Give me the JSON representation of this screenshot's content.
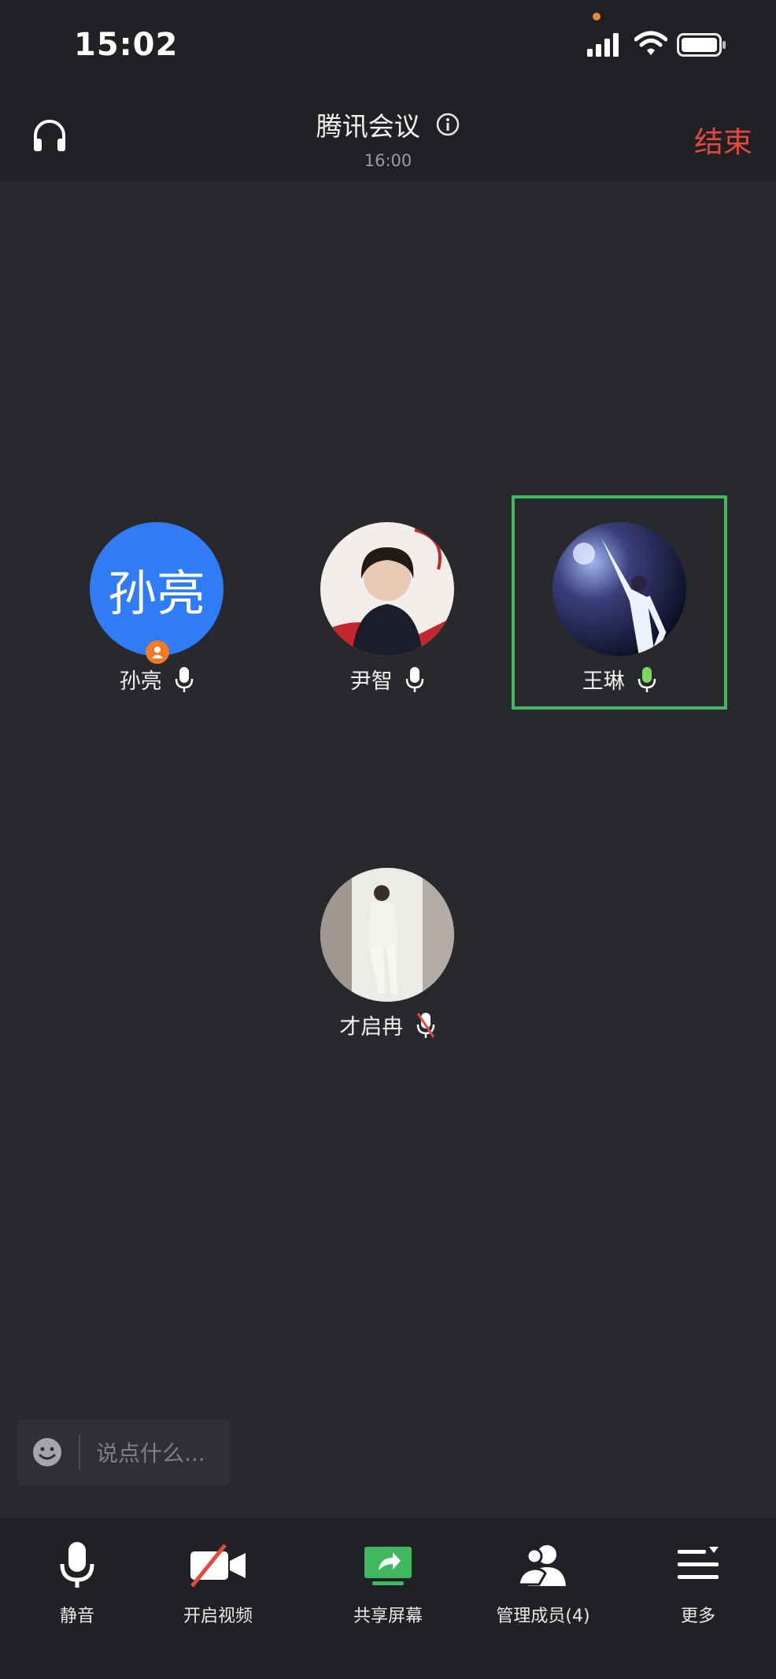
{
  "status_bar": {
    "time": "15:02",
    "icons": [
      "signal-icon",
      "wifi-icon",
      "battery-icon"
    ]
  },
  "header": {
    "title": "腾讯会议",
    "time": "16:00",
    "end_label": "结束",
    "end_color": "#e2493f",
    "icons": [
      "headset-icon",
      "info-icon"
    ]
  },
  "participants": [
    {
      "name": "孙亮",
      "avatar_text": "孙亮",
      "mic": "on",
      "host": true,
      "avatar_color": "#2f7cf6"
    },
    {
      "name": "尹智",
      "mic": "on"
    },
    {
      "name": "王琳",
      "mic": "speaking",
      "active": true,
      "active_color": "#3fb860"
    },
    {
      "name": "才启冉",
      "mic": "muted"
    }
  ],
  "chat": {
    "placeholder": "说点什么..."
  },
  "toolbar": {
    "mute_label": "静音",
    "video_label": "开启视频",
    "share_label": "共享屏幕",
    "members_label": "管理成员(4)",
    "more_label": "更多",
    "share_color": "#3fb860"
  }
}
